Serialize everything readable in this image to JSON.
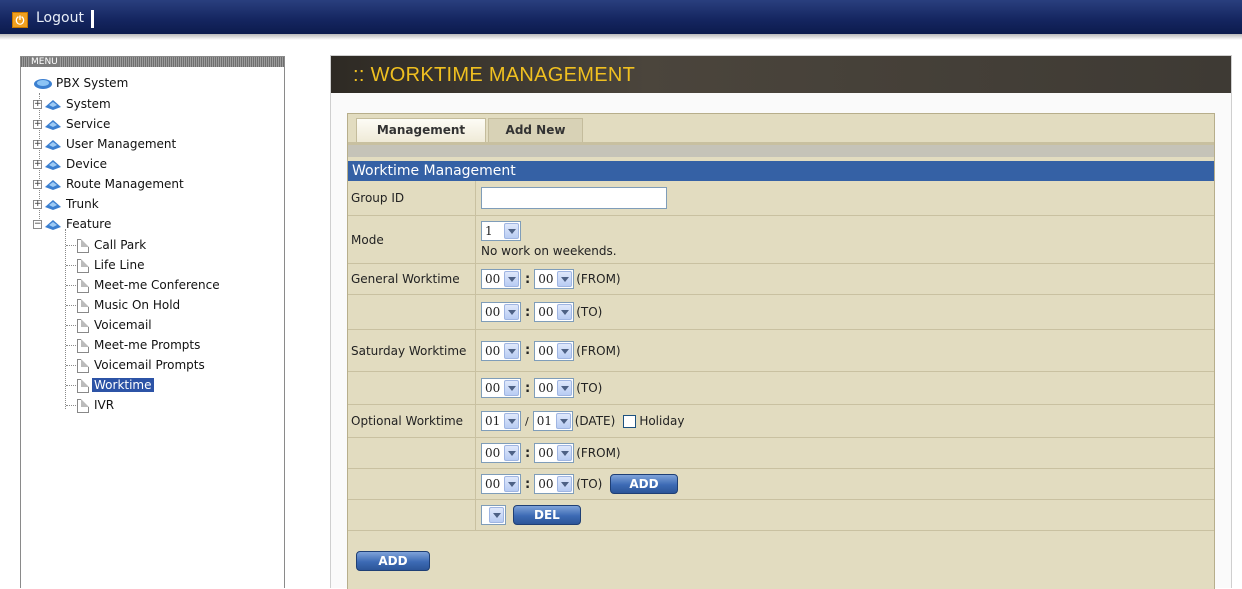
{
  "topbar": {
    "logout_label": "Logout"
  },
  "menu": {
    "title": "MENU",
    "root": "PBX System",
    "groups": [
      "System",
      "Service",
      "User Management",
      "Device",
      "Route Management",
      "Trunk",
      "Feature"
    ],
    "feature_items": [
      "Call Park",
      "Life Line",
      "Meet-me Conference",
      "Music On Hold",
      "Voicemail",
      "Meet-me Prompts",
      "Voicemail Prompts",
      "Worktime",
      "IVR"
    ],
    "selected": "Worktime"
  },
  "page": {
    "title": ":: WORKTIME MANAGEMENT",
    "tabs": [
      {
        "label": "Management"
      },
      {
        "label": "Add New"
      }
    ],
    "active_tab": "Add New",
    "section_title": "Worktime Management"
  },
  "form": {
    "group_id": {
      "label": "Group ID",
      "value": ""
    },
    "mode": {
      "label": "Mode",
      "value": "1",
      "note": "No work on weekends."
    },
    "general_worktime": {
      "label": "General Worktime",
      "from_hour": "00",
      "from_min": "00",
      "from_label": "(FROM)",
      "to_hour": "00",
      "to_min": "00",
      "to_label": "(TO)"
    },
    "saturday_worktime": {
      "label": "Saturday Worktime",
      "from_hour": "00",
      "from_min": "00",
      "from_label": "(FROM)",
      "to_hour": "00",
      "to_min": "00",
      "to_label": "(TO)"
    },
    "optional_worktime": {
      "label": "Optional Worktime",
      "month": "01",
      "day": "01",
      "date_label": "(DATE)",
      "holiday_label": "Holiday",
      "holiday_checked": false,
      "from_hour": "00",
      "from_min": "00",
      "from_label": "(FROM)",
      "to_hour": "00",
      "to_min": "00",
      "to_label": "(TO)",
      "add_label": "ADD",
      "list_value": "",
      "del_label": "DEL"
    },
    "submit_label": "ADD"
  }
}
